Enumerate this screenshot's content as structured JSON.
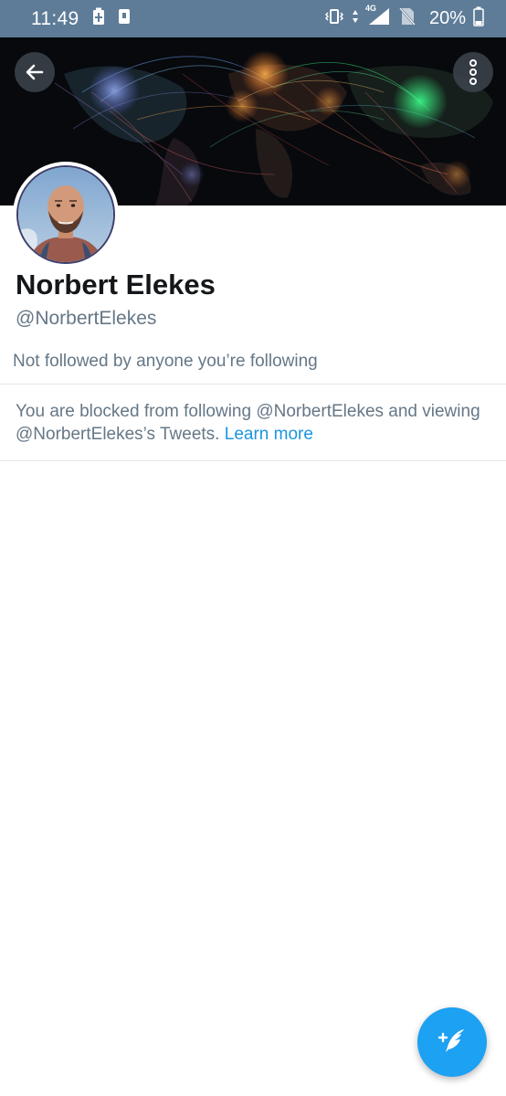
{
  "status_bar": {
    "time": "11:49",
    "battery_percent": "20%",
    "network_label": "4G"
  },
  "header": {
    "back_icon": "arrow-left-icon",
    "more_icon": "more-vertical-icon"
  },
  "profile": {
    "display_name": "Norbert Elekes",
    "handle": "@NorbertElekes",
    "followed_by": "Not followed by anyone you’re following"
  },
  "blocked_notice": {
    "text": "You are blocked from following @NorbertElekes and viewing @NorbertElekes’s Tweets.",
    "link_text": "Learn more"
  },
  "fab": {
    "icon": "compose-tweet-icon"
  },
  "colors": {
    "status_bar_bg": "#5e7c97",
    "accent": "#1da1f2",
    "link": "#1b95e0",
    "secondary_text": "#657786"
  }
}
